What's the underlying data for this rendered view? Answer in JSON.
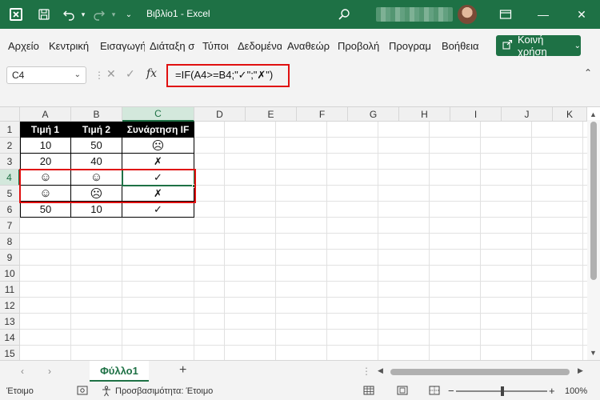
{
  "window": {
    "title": "Βιβλίο1  -  Excel",
    "minimize": "—",
    "maximize": "☐",
    "close": "✕"
  },
  "menu": {
    "items": [
      "Αρχείο",
      "Κεντρική",
      "Εισαγωγή",
      "Διάταξη σ",
      "Τύποι",
      "Δεδομένα",
      "Αναθεώρ",
      "Προβολή",
      "Προγραμ",
      "Βοήθεια"
    ],
    "share_label": "Κοινή χρήση"
  },
  "formula_bar": {
    "name_box": "C4",
    "fx": "fx",
    "formula": "=IF(A4>=B4;\"✓\";\"✗\")"
  },
  "columns": [
    "A",
    "B",
    "C",
    "D",
    "E",
    "F",
    "G",
    "H",
    "I",
    "J",
    "K"
  ],
  "rows": [
    "1",
    "2",
    "3",
    "4",
    "5",
    "6",
    "7",
    "8",
    "9",
    "10",
    "11",
    "12",
    "13",
    "14",
    "15"
  ],
  "table": {
    "headers": [
      "Τιμή 1",
      "Τιμή 2",
      "Συνάρτηση IF"
    ],
    "data": [
      [
        "10",
        "50",
        "☹"
      ],
      [
        "20",
        "40",
        "✗"
      ],
      [
        "☺",
        "☺",
        "✓"
      ],
      [
        "☺",
        "☹",
        "✗"
      ],
      [
        "50",
        "10",
        "✓"
      ]
    ]
  },
  "sheets": {
    "tabs": [
      "Φύλλο1"
    ],
    "add": "+"
  },
  "status": {
    "ready": "Έτοιμο",
    "accessibility": "Προσβασιμότητα: Έτοιμο",
    "zoom": "100%"
  },
  "colors": {
    "excel_green": "#1e7145",
    "highlight_red": "#e01010"
  }
}
